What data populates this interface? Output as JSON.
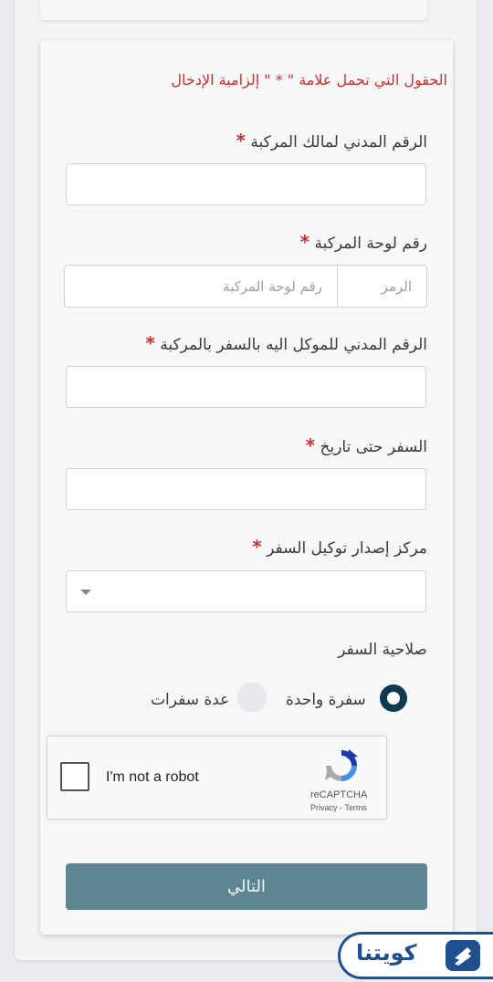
{
  "form": {
    "required_notice": "الحقول التي تحمل علامة \" * \" إلزامية الإدخال",
    "required_mark": "*",
    "owner_civil_id": {
      "label": "الرقم المدني لمالك المركبة",
      "value": ""
    },
    "plate": {
      "label": "رقم لوحة المركبة",
      "code_placeholder": "الرمز",
      "number_placeholder": "رقم لوحة المركبة"
    },
    "authorized_civil_id": {
      "label": "الرقم المدني للموكل اليه بالسفر بالمركبة",
      "value": ""
    },
    "travel_until": {
      "label": "السفر حتى تاريخ",
      "value": ""
    },
    "center": {
      "label": "مركز إصدار توكيل السفر",
      "selected": ""
    },
    "validity": {
      "label": "صلاحية السفر",
      "options": [
        {
          "label": "سفرة واحدة",
          "selected": true
        },
        {
          "label": "عدة سفرات",
          "selected": false
        }
      ]
    },
    "recaptcha": {
      "label": "I'm not a robot",
      "brand": "reCAPTCHA",
      "privacy": "Privacy",
      "separator": " - ",
      "terms": "Terms"
    },
    "next_button": "التالي"
  },
  "logo": {
    "text": "كويتنا",
    "icon": "kuwaitna-logo-icon"
  },
  "colors": {
    "required_red": "#c8312d",
    "radio_selected": "#0e3b4f",
    "button_bg": "#5d8695",
    "logo_blue": "#1e4f8f"
  }
}
